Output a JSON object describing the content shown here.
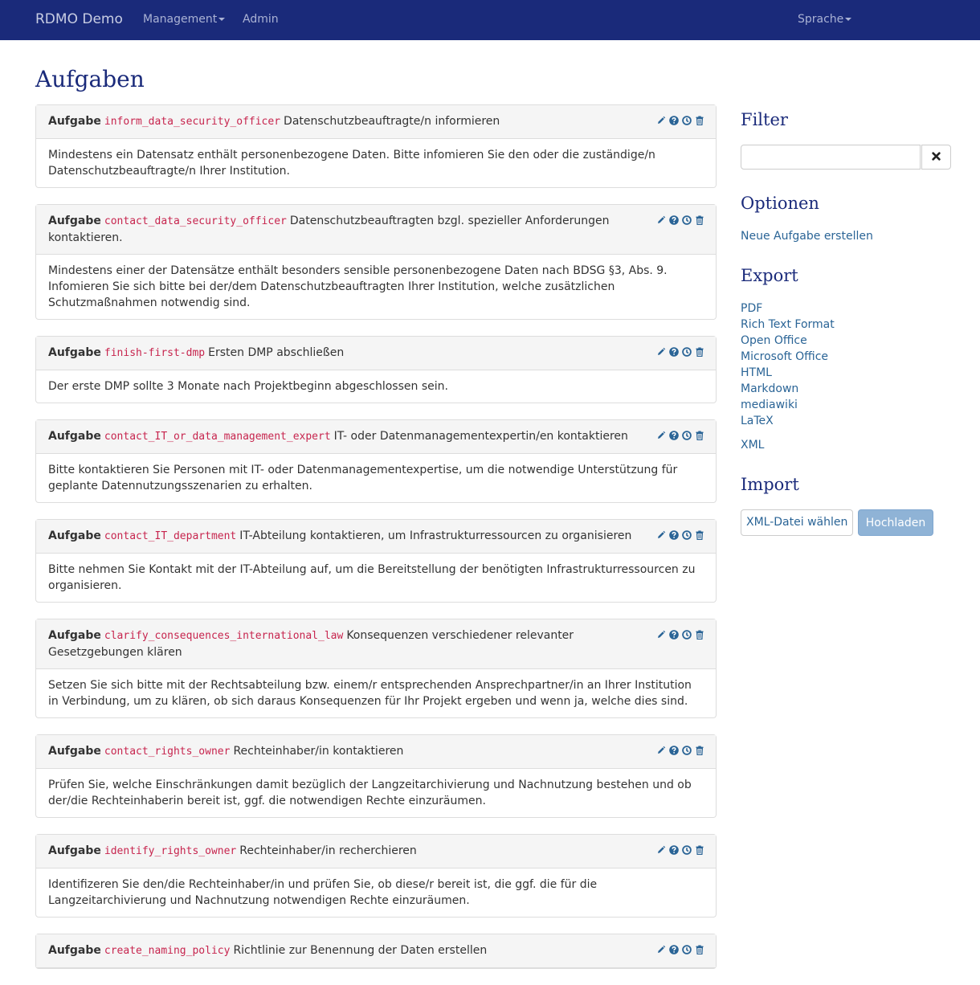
{
  "navbar": {
    "brand": "RDMO Demo",
    "management": "Management",
    "admin": "Admin",
    "language": "Sprache"
  },
  "page_title": "Aufgaben",
  "task_keyword": "Aufgabe",
  "tasks": [
    {
      "key": "inform_data_security_officer",
      "title": "Datenschutzbeauftragte/n informieren",
      "text": "Mindestens ein Datensatz enthält personenbezogene Daten. Bitte infomieren Sie den oder die zuständige/n Datenschutzbeauftragte/n Ihrer Institution."
    },
    {
      "key": "contact_data_security_officer",
      "title": "Datenschutzbeauftragten bzgl. spezieller Anforderungen kontaktieren.",
      "text": "Mindestens einer der Datensätze enthält besonders sensible personenbezogene Daten nach BDSG §3, Abs. 9. Infomieren Sie sich bitte bei der/dem Datenschutzbeauftragten Ihrer Institution, welche zusätzlichen Schutzmaßnahmen notwendig sind."
    },
    {
      "key": "finish-first-dmp",
      "title": "Ersten DMP abschließen",
      "text": "Der erste DMP sollte 3 Monate nach Projektbeginn abgeschlossen sein."
    },
    {
      "key": "contact_IT_or_data_management_expert",
      "title": "IT- oder Datenmanagementexpertin/en kontaktieren",
      "text": "Bitte kontaktieren Sie Personen mit IT- oder Datenmanagementexpertise, um die notwendige Unterstützung für geplante Datennutzungsszenarien zu erhalten."
    },
    {
      "key": "contact_IT_department",
      "title": "IT-Abteilung kontaktieren, um Infrastrukturressourcen zu organisieren",
      "text": "Bitte nehmen Sie Kontakt mit der IT-Abteilung auf, um die Bereitstellung der benötigten Infrastrukturressourcen zu organisieren."
    },
    {
      "key": "clarify_consequences_international_law",
      "title": "Konsequenzen verschiedener relevanter Gesetzgebungen klären",
      "text": "Setzen Sie sich bitte mit der Rechtsabteilung bzw. einem/r entsprechenden Ansprechpartner/in an Ihrer Institution in Verbindung, um zu klären, ob sich daraus Konsequenzen für Ihr Projekt ergeben und wenn ja, welche dies sind."
    },
    {
      "key": "contact_rights_owner",
      "title": "Rechteinhaber/in kontaktieren",
      "text": "Prüfen Sie, welche Einschränkungen damit bezüglich der Langzeitarchivierung und Nachnutzung bestehen und ob der/die Rechteinhaberin bereit ist, ggf. die notwendigen Rechte einzuräumen."
    },
    {
      "key": "identify_rights_owner",
      "title": "Rechteinhaber/in recherchieren",
      "text": "Identifizeren Sie den/die Rechteinhaber/in und prüfen Sie, ob diese/r bereit ist, die ggf. die für die Langzeitarchivierung und Nachnutzung notwendigen Rechte einzuräumen."
    },
    {
      "key": "create_naming_policy",
      "title": "Richtlinie zur Benennung der Daten erstellen",
      "text": ""
    }
  ],
  "sidebar": {
    "filter_heading": "Filter",
    "options_heading": "Optionen",
    "create_task": "Neue Aufgabe erstellen",
    "export_heading": "Export",
    "export_links": [
      "PDF",
      "Rich Text Format",
      "Open Office",
      "Microsoft Office",
      "HTML",
      "Markdown",
      "mediawiki",
      "LaTeX"
    ],
    "xml_link": "XML",
    "import_heading": "Import",
    "choose_file": "XML-Datei wählen",
    "upload": "Hochladen"
  },
  "icons": {
    "edit": "pencil-icon",
    "help": "question-icon",
    "conditions": "clock-icon",
    "delete": "trash-icon",
    "clear_filter": "close-icon"
  },
  "colors": {
    "navbar": "#1a2a7a",
    "heading": "#1a2a7a",
    "link": "#2a6496",
    "code": "#c7254e"
  }
}
